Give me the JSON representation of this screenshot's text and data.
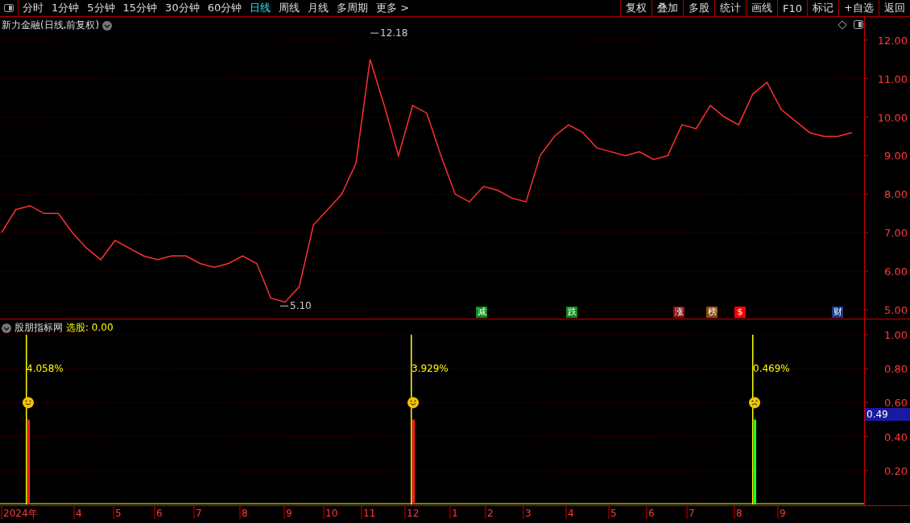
{
  "toolbar": {
    "periods": [
      {
        "label": "分时",
        "selected": false
      },
      {
        "label": "1分钟",
        "selected": false
      },
      {
        "label": "5分钟",
        "selected": false
      },
      {
        "label": "15分钟",
        "selected": false
      },
      {
        "label": "30分钟",
        "selected": false
      },
      {
        "label": "60分钟",
        "selected": false
      },
      {
        "label": "日线",
        "selected": true
      },
      {
        "label": "周线",
        "selected": false
      },
      {
        "label": "月线",
        "selected": false
      },
      {
        "label": "多周期",
        "selected": false
      },
      {
        "label": "更多 >",
        "selected": false
      }
    ],
    "buttons": [
      "复权",
      "叠加",
      "多股",
      "统计",
      "画线",
      "F10",
      "标记",
      "+自选",
      "返回"
    ]
  },
  "price_panel": {
    "title": "新力金融(日线,前复权)",
    "chart_data": {
      "type": "line",
      "series": [
        {
          "color": "#ff3030",
          "values": [
            7.0,
            7.6,
            7.7,
            7.5,
            7.5,
            7.0,
            6.6,
            6.3,
            6.8,
            6.6,
            6.4,
            6.3,
            6.4,
            6.4,
            6.2,
            6.1,
            6.2,
            6.4,
            6.2,
            5.3,
            5.2,
            5.6,
            7.2,
            7.6,
            8.0,
            8.8,
            11.5,
            10.3,
            9.0,
            10.3,
            10.1,
            9.0,
            8.0,
            7.8,
            8.2,
            8.1,
            7.9,
            7.8,
            9.0,
            9.5,
            9.8,
            9.6,
            9.2,
            9.1,
            9.0,
            9.1,
            8.9,
            9.0,
            9.8,
            9.7,
            10.3,
            10.0,
            9.8,
            10.6,
            10.9,
            10.2,
            9.9,
            9.6,
            9.5,
            9.5,
            9.6
          ]
        }
      ],
      "ylim": [
        4.75,
        12.6
      ],
      "grid": true,
      "yticks": [
        {
          "value": 5,
          "label": "5.00"
        },
        {
          "value": 6,
          "label": "6.00"
        },
        {
          "value": 7,
          "label": "7.00"
        },
        {
          "value": 8,
          "label": "8.00"
        },
        {
          "value": 9,
          "label": "9.00"
        },
        {
          "value": 10,
          "label": "10.00"
        },
        {
          "value": 11,
          "label": "11.00"
        },
        {
          "value": 12,
          "label": "12.00"
        }
      ],
      "annotations": [
        "12.18",
        "5.10"
      ]
    },
    "event_tags": [
      {
        "label": "减",
        "color": "#0a8a1a"
      },
      {
        "label": "跌",
        "color": "#0a8a1a"
      },
      {
        "label": "涨",
        "color": "#8a1010"
      },
      {
        "label": "榜",
        "color": "#8a4a10"
      },
      {
        "label": "$",
        "color": "#ff0000"
      },
      {
        "label": "财",
        "color": "#1a3a8a"
      }
    ]
  },
  "indicator_panel": {
    "title": "股朋指标网",
    "readout_label": "选股:",
    "readout_value": "0.00",
    "cursor_value": "0.49",
    "signals": [
      {
        "label": "4.058%",
        "kind": "smile"
      },
      {
        "label": "3.929%",
        "kind": "smile"
      },
      {
        "label": "0.469%",
        "kind": "frown"
      }
    ],
    "chart_data": {
      "type": "bar",
      "series": [
        {
          "color": "#ffff00",
          "values": [
            1,
            1,
            1
          ]
        },
        {
          "color": "#ff2020",
          "values": [
            0.5,
            0.5,
            null
          ]
        },
        {
          "color": "#20ff20",
          "values": [
            null,
            null,
            0.5
          ]
        }
      ],
      "ylim": [
        0,
        1.09
      ],
      "grid": true,
      "yticks": [
        {
          "value": 0.2,
          "label": "0.20"
        },
        {
          "value": 0.4,
          "label": "0.40"
        },
        {
          "value": 0.6,
          "label": "0.60"
        },
        {
          "value": 0.8,
          "label": "0.80"
        },
        {
          "value": 1.0,
          "label": "1.00"
        }
      ]
    }
  },
  "x_axis": {
    "ticks": [
      "2024年",
      "4",
      "5",
      "6",
      "7",
      "8",
      "9",
      "10",
      "11",
      "12",
      "1",
      "2",
      "3",
      "4",
      "5",
      "6",
      "7",
      "8",
      "9"
    ]
  }
}
